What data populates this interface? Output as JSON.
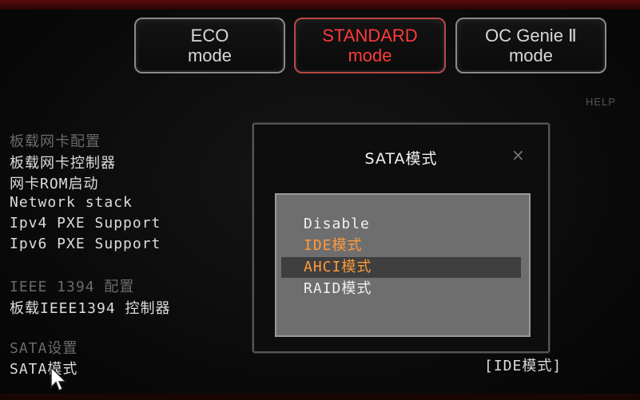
{
  "modes": [
    {
      "line1": "ECO",
      "line2": "mode"
    },
    {
      "line1": "STANDARD",
      "line2": "mode"
    },
    {
      "line1": "OC Genie Ⅱ",
      "line2": "mode"
    }
  ],
  "help_label": "HELP",
  "left_menu": [
    "板载网卡配置",
    "板载网卡控制器",
    "网卡ROM启动",
    "Network stack",
    "Ipv4 PXE Support",
    "Ipv6 PXE Support",
    "IEEE 1394 配置",
    "板载IEEE1394 控制器",
    "SATA设置",
    "SATA模式"
  ],
  "sata_value": "[IDE模式]",
  "dialog": {
    "title": "SATA模式",
    "close": "×",
    "options": [
      "Disable",
      "IDE模式",
      "AHCI模式",
      "RAID模式"
    ]
  },
  "colors": {
    "active_mode": "#ff3a3a",
    "highlight_option": "#ff9a3a",
    "option_bg": "#6e6e6e",
    "selected_bg": "#3f3f3f"
  }
}
